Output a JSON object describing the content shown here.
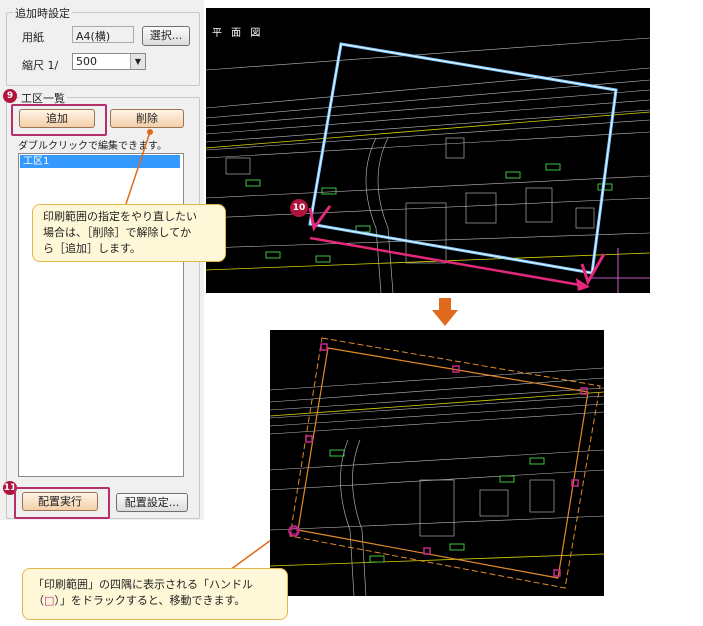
{
  "settings": {
    "group_title": "追加時設定",
    "paper_label": "用紙",
    "paper_value": "A4(横)",
    "select_button": "選択...",
    "scale_label": "縮尺 1/",
    "scale_value": "500"
  },
  "sections": {
    "group_title": "工区一覧",
    "add_button": "追加",
    "delete_button": "削除",
    "hint": "ダブルクリックで編集できます。",
    "items": [
      "工区1"
    ],
    "execute_button": "配置実行",
    "settings_button": "配置設定..."
  },
  "badges": {
    "nine": "9",
    "ten": "10",
    "eleven": "11"
  },
  "cad_top": {
    "title": "平 面 図"
  },
  "callout1": {
    "line1": "印刷範囲の指定をやり直したい",
    "line2": "場合は、［削除］で解除してか",
    "line3": "ら［追加］します。"
  },
  "callout2": {
    "line1": "「印刷範囲」の四隅に表示される「ハンドル",
    "line2_a": "（",
    "line2_handle": "□",
    "line2_b": "）」をドラックすると、移動できます。"
  },
  "colors": {
    "accent": "#b5306b",
    "arrow": "#e06a1b",
    "handle": "#c8288a"
  }
}
